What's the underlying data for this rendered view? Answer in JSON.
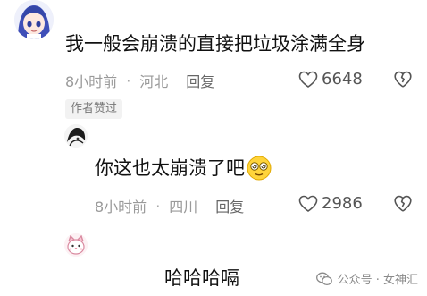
{
  "comments": [
    {
      "text": "我一般会崩溃的直接把垃圾涂满全身",
      "time": "8小时前",
      "separator": "·",
      "location": "河北",
      "reply_label": "回复",
      "likes": "6648",
      "author_tag": "作者赞过",
      "avatar": "anime-girl-avatar"
    },
    {
      "text": "你这也太崩溃了吧",
      "emoji": "dizzy-face-emoji",
      "time": "8小时前",
      "separator": "·",
      "location": "四川",
      "reply_label": "回复",
      "likes": "2986",
      "avatar": "dark-sketch-avatar"
    },
    {
      "text": "哈哈哈嗝",
      "avatar": "pink-cat-avatar"
    }
  ],
  "watermark": {
    "text": "公众号 · 女神汇",
    "icon": "wechat-icon"
  },
  "colors": {
    "text": "#111111",
    "meta": "#9a9a9a",
    "tag_bg": "#f2f2f2"
  }
}
